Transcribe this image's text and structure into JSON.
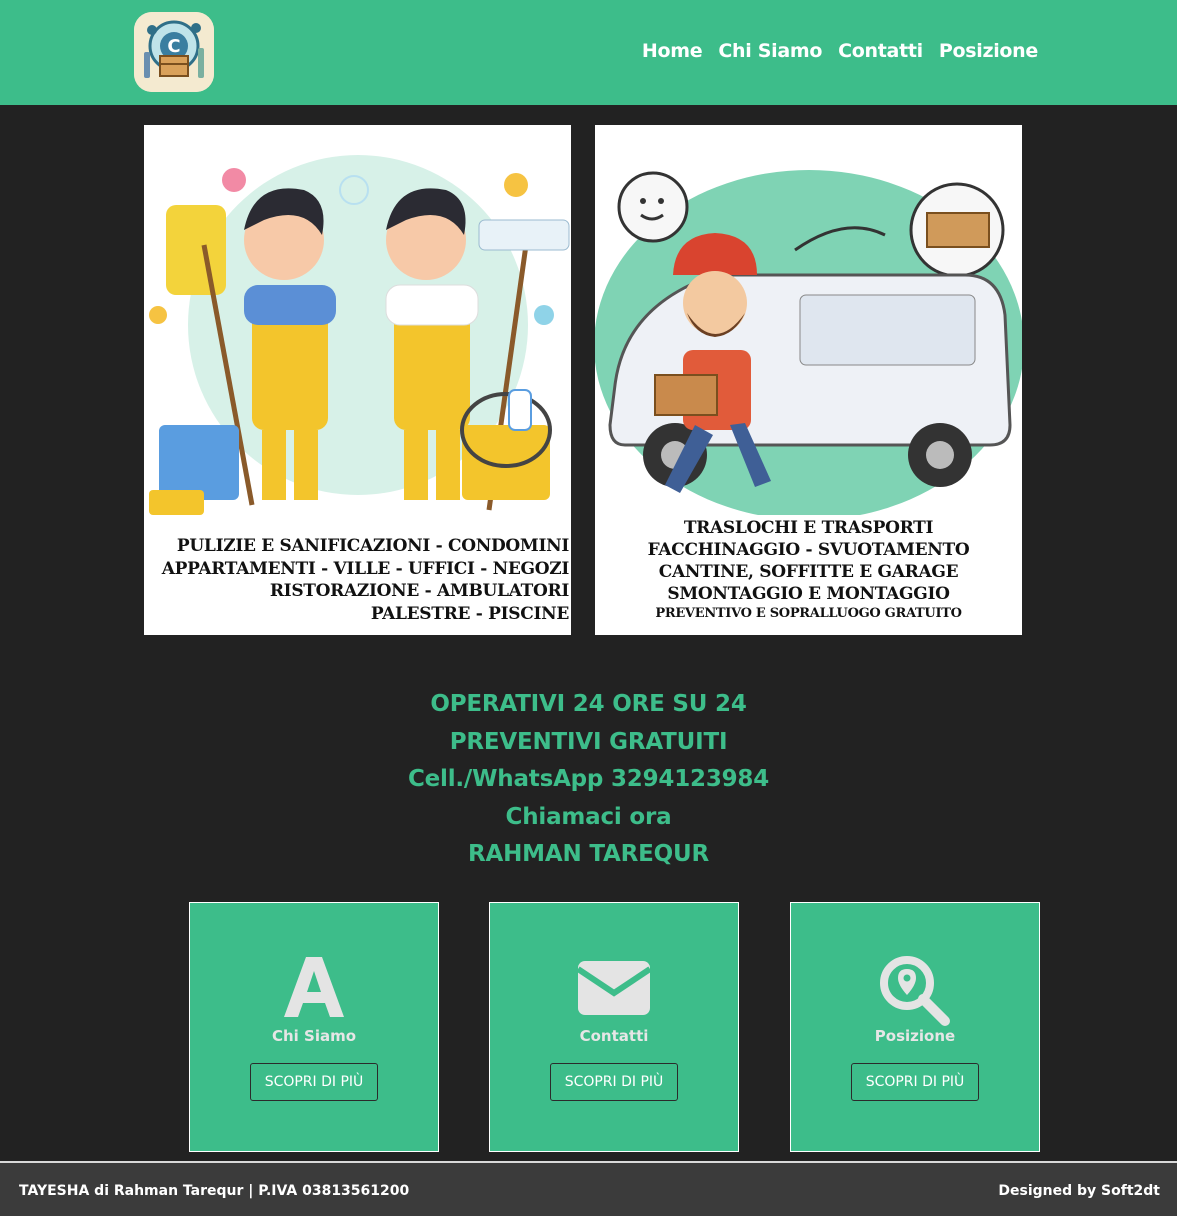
{
  "header": {
    "logo_alt": "logo",
    "nav": [
      "Home",
      "Chi Siamo",
      "Contatti",
      "Posizione"
    ]
  },
  "posters": {
    "left": {
      "lines": [
        "PULIZIE E SANIFICAZIONI - CONDOMINI",
        "APPARTAMENTI - VILLE - UFFICI - NEGOZI",
        "RISTORAZIONE - AMBULATORI",
        "PALESTRE - PISCINE"
      ]
    },
    "right": {
      "lines": [
        "TRASLOCHI E TRASPORTI",
        "FACCHINAGGIO - SVUOTAMENTO",
        "CANTINE, SOFFITTE E GARAGE",
        "SMONTAGGIO E MONTAGGIO"
      ],
      "small_line": "PREVENTIVO E SOPRALLUOGO GRATUITO"
    }
  },
  "info": [
    "OPERATIVI 24 ORE SU 24",
    "PREVENTIVI GRATUITI",
    "Cell./WhatsApp 3294123984",
    "Chiamaci ora",
    "RAHMAN TAREQUR"
  ],
  "cards": [
    {
      "icon": "letter-a-icon",
      "label": "Chi Siamo",
      "button": "SCOPRI DI PIÙ"
    },
    {
      "icon": "envelope-icon",
      "label": "Contatti",
      "button": "SCOPRI DI PIÙ"
    },
    {
      "icon": "map-search-icon",
      "label": "Posizione",
      "button": "SCOPRI DI PIÙ"
    }
  ],
  "footer": {
    "left": "TAYESHA di Rahman Tarequr | P.IVA 03813561200",
    "right": "Designed by Soft2dt"
  },
  "colors": {
    "brand": "#3dbd8a",
    "background": "#222222",
    "footer": "#3b3b3b"
  }
}
